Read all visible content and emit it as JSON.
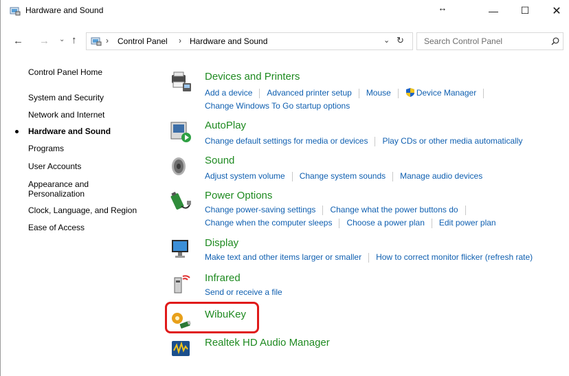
{
  "window": {
    "title": "Hardware and Sound",
    "resize_glyph": "↔",
    "minimize_glyph": "—",
    "maximize_glyph": "☐",
    "close_glyph": "✕"
  },
  "address": {
    "back_glyph": "←",
    "forward_glyph": "→",
    "recent_glyph": "⌄",
    "up_glyph": "↑",
    "separator": "›",
    "crumbs": [
      "Control Panel",
      "Hardware and Sound"
    ],
    "dropdown_glyph": "⌄",
    "refresh_glyph": "↻",
    "search_placeholder": "Search Control Panel"
  },
  "sidebar": {
    "items": [
      {
        "label": "Control Panel Home"
      },
      {
        "label": "System and Security"
      },
      {
        "label": "Network and Internet"
      },
      {
        "label": "Hardware and Sound",
        "active": true
      },
      {
        "label": "Programs"
      },
      {
        "label": "User Accounts"
      },
      {
        "label": "Appearance and Personalization"
      },
      {
        "label": "Clock, Language, and Region"
      },
      {
        "label": "Ease of Access"
      }
    ]
  },
  "categories": {
    "devices": {
      "title": "Devices and Printers",
      "icon": "printer-icon",
      "links1": [
        "Add a device",
        "Advanced printer setup",
        "Mouse",
        "Device Manager"
      ],
      "links2": [
        "Change Windows To Go startup options"
      ]
    },
    "autoplay": {
      "title": "AutoPlay",
      "icon": "autoplay-icon",
      "links1": [
        "Change default settings for media or devices",
        "Play CDs or other media automatically"
      ]
    },
    "sound": {
      "title": "Sound",
      "icon": "speaker-icon",
      "links1": [
        "Adjust system volume",
        "Change system sounds",
        "Manage audio devices"
      ]
    },
    "power": {
      "title": "Power Options",
      "icon": "battery-icon",
      "links1": [
        "Change power-saving settings",
        "Change what the power buttons do"
      ],
      "links2": [
        "Change when the computer sleeps",
        "Choose a power plan",
        "Edit power plan"
      ]
    },
    "display": {
      "title": "Display",
      "icon": "monitor-icon",
      "links1": [
        "Make text and other items larger or smaller",
        "How to correct monitor flicker (refresh rate)"
      ]
    },
    "infrared": {
      "title": "Infrared",
      "icon": "infrared-icon",
      "links1": [
        "Send or receive a file"
      ]
    },
    "wibukey": {
      "title": "WibuKey",
      "icon": "wibukey-icon"
    },
    "realtek": {
      "title": "Realtek HD Audio Manager",
      "icon": "realtek-audio-icon"
    }
  },
  "colors": {
    "title_green": "#1e8a20",
    "link_blue": "#0f5fb0",
    "highlight_red": "#e01a1a"
  }
}
